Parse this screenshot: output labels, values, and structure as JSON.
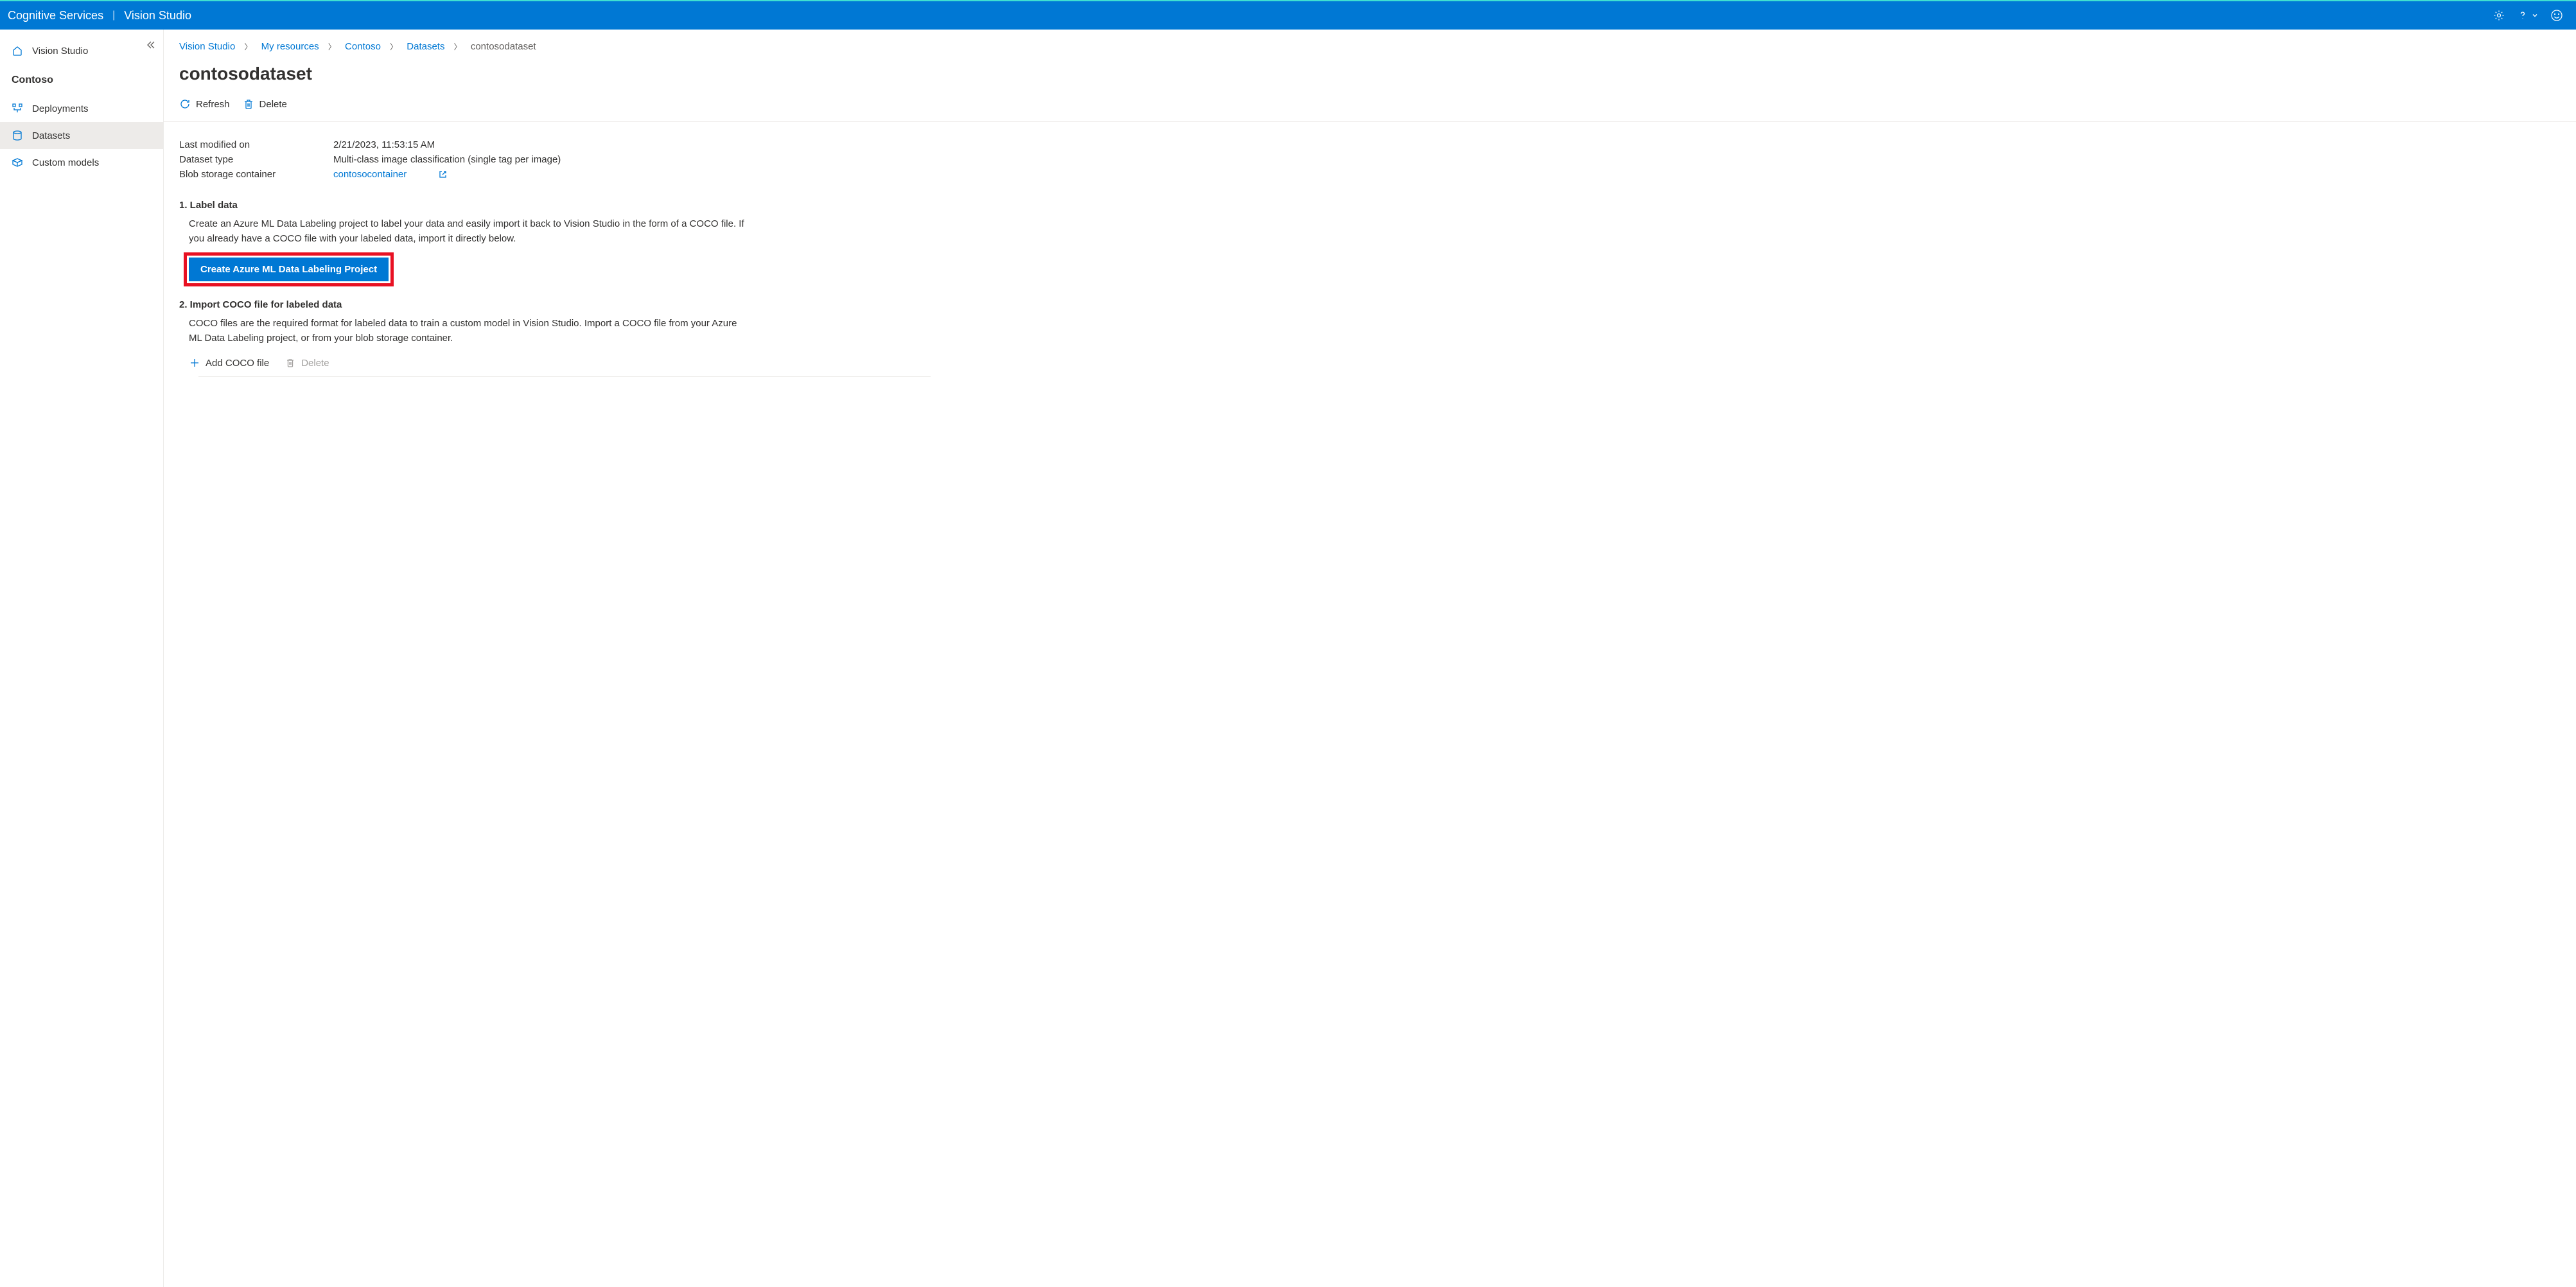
{
  "header": {
    "title": "Cognitive Services",
    "subtitle": "Vision Studio"
  },
  "sidebar": {
    "home_label": "Vision Studio",
    "org_label": "Contoso",
    "items": [
      {
        "label": "Deployments"
      },
      {
        "label": "Datasets"
      },
      {
        "label": "Custom models"
      }
    ]
  },
  "breadcrumb": {
    "items": [
      "Vision Studio",
      "My resources",
      "Contoso",
      "Datasets"
    ],
    "current": "contosodataset"
  },
  "page_title": "contosodataset",
  "toolbar": {
    "refresh_label": "Refresh",
    "delete_label": "Delete"
  },
  "info": {
    "last_modified_label": "Last modified on",
    "last_modified_value": "2/21/2023, 11:53:15 AM",
    "dataset_type_label": "Dataset type",
    "dataset_type_value": "Multi-class image classification (single tag per image)",
    "blob_label": "Blob storage container",
    "blob_value": "contosocontainer"
  },
  "section1": {
    "title": "1. Label data",
    "body": "Create an Azure ML Data Labeling project to label your data and easily import it back to Vision Studio in the form of a COCO file. If you already have a COCO file with your labeled data, import it directly below.",
    "button": "Create Azure ML Data Labeling Project"
  },
  "section2": {
    "title": "2. Import COCO file for labeled data",
    "body": "COCO files are the required format for labeled data to train a custom model in Vision Studio. Import a COCO file from your Azure ML Data Labeling project, or from your blob storage container.",
    "add_label": "Add COCO file",
    "delete_label": "Delete"
  }
}
